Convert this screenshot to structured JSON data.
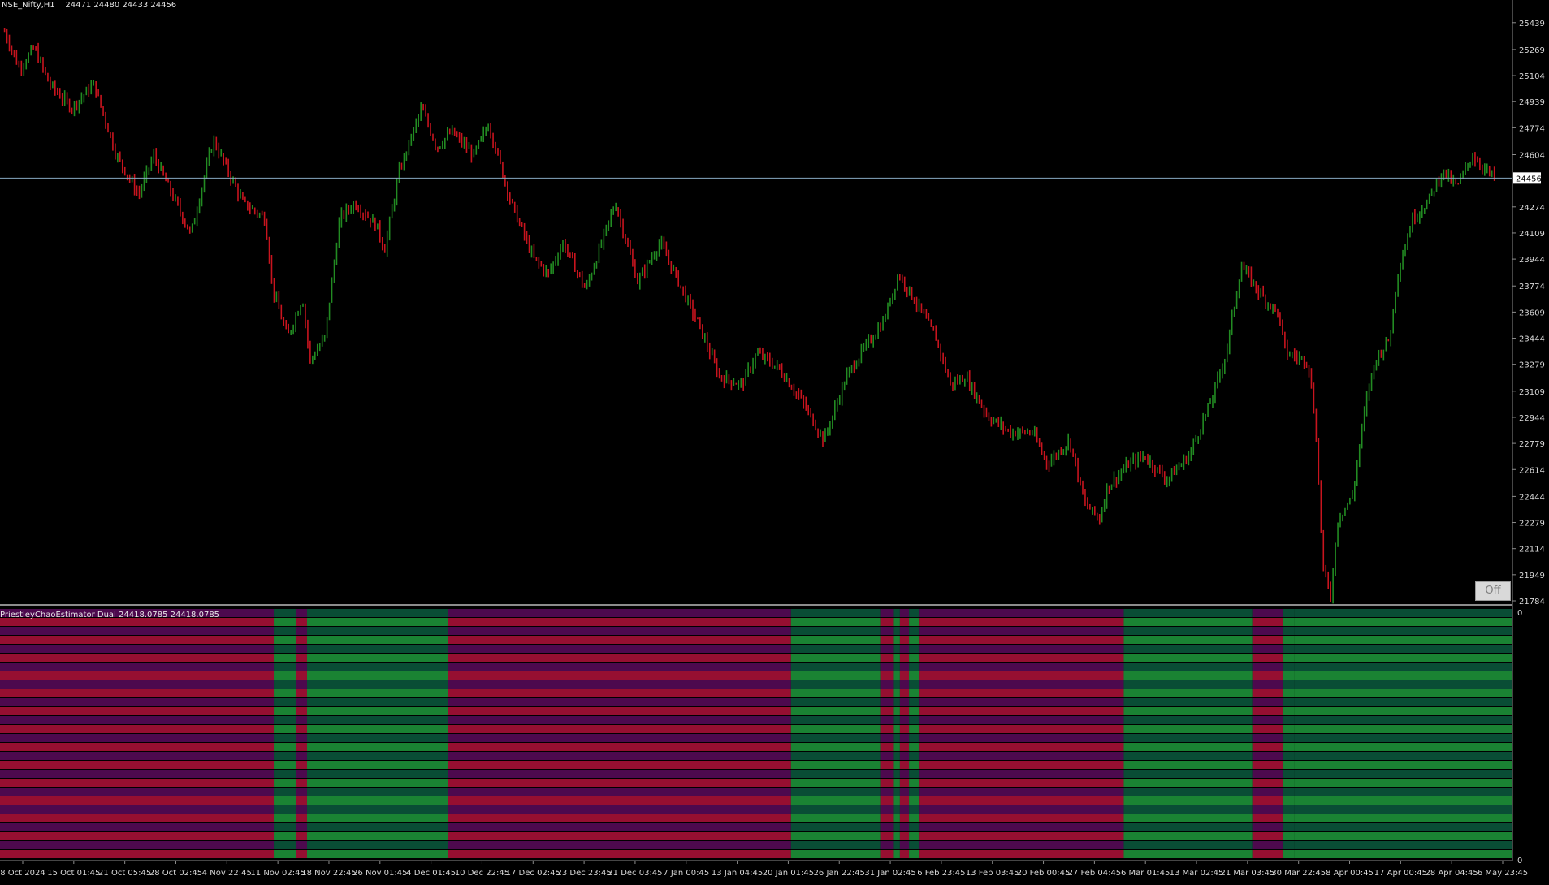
{
  "header": {
    "symbol": "NSE_Nifty,H1",
    "ohlc": "24471 24480 24433 24456"
  },
  "indicator": {
    "label": "PriestleyChaoEstimator Dual 24418.0785 24418.0785",
    "scale_top": "0",
    "scale_bottom": "0"
  },
  "off_button": {
    "label": "Off"
  },
  "colors": {
    "background": "#000000",
    "bull": "#228B22",
    "bear": "#C8141E",
    "current_price_line": "#87a9c2",
    "grid_text": "#d8d8d8",
    "heat_bear": "#b0123a",
    "heat_bear_alt": "#5a0a5c",
    "heat_bull": "#1e9a3c",
    "heat_bull_alt": "#0b5a3e"
  },
  "chart_data": {
    "type": "candlestick",
    "timeframe": "H1",
    "current_price": 24456,
    "current_price_label": "24456",
    "ylim": [
      21784,
      25520
    ],
    "y_ticks": [
      "25439",
      "25269",
      "25104",
      "24939",
      "24774",
      "24604",
      "24274",
      "24109",
      "23944",
      "23774",
      "23609",
      "23444",
      "23279",
      "23109",
      "22944",
      "22779",
      "22614",
      "22444",
      "22279",
      "22114",
      "21949",
      "21784"
    ],
    "x_ticks": [
      "8 Oct 2024",
      "15 Oct 01:45",
      "21 Oct 05:45",
      "28 Oct 02:45",
      "4 Nov 22:45",
      "11 Nov 02:45",
      "18 Nov 22:45",
      "26 Nov 01:45",
      "4 Dec 01:45",
      "10 Dec 22:45",
      "17 Dec 02:45",
      "23 Dec 23:45",
      "31 Dec 03:45",
      "7 Jan 00:45",
      "13 Jan 04:45",
      "20 Jan 01:45",
      "26 Jan 22:45",
      "31 Jan 02:45",
      "6 Feb 23:45",
      "13 Feb 03:45",
      "20 Feb 00:45",
      "27 Feb 04:45",
      "6 Mar 01:45",
      "13 Mar 02:45",
      "21 Mar 03:45",
      "30 Mar 22:45",
      "8 Apr 00:45",
      "17 Apr 00:45",
      "28 Apr 04:45",
      "6 May 23:45"
    ],
    "price_path": [
      [
        0,
        25380
      ],
      [
        0.01,
        25150
      ],
      [
        0.02,
        25280
      ],
      [
        0.03,
        25050
      ],
      [
        0.045,
        24900
      ],
      [
        0.06,
        25050
      ],
      [
        0.075,
        24600
      ],
      [
        0.09,
        24350
      ],
      [
        0.1,
        24600
      ],
      [
        0.11,
        24400
      ],
      [
        0.125,
        24100
      ],
      [
        0.14,
        24700
      ],
      [
        0.16,
        24300
      ],
      [
        0.175,
        24200
      ],
      [
        0.18,
        23750
      ],
      [
        0.19,
        23450
      ],
      [
        0.2,
        23700
      ],
      [
        0.205,
        23300
      ],
      [
        0.215,
        23450
      ],
      [
        0.225,
        24200
      ],
      [
        0.235,
        24300
      ],
      [
        0.25,
        24150
      ],
      [
        0.255,
        24000
      ],
      [
        0.265,
        24500
      ],
      [
        0.28,
        24900
      ],
      [
        0.29,
        24650
      ],
      [
        0.3,
        24750
      ],
      [
        0.315,
        24600
      ],
      [
        0.325,
        24800
      ],
      [
        0.34,
        24300
      ],
      [
        0.355,
        23950
      ],
      [
        0.365,
        23850
      ],
      [
        0.375,
        24050
      ],
      [
        0.39,
        23750
      ],
      [
        0.41,
        24300
      ],
      [
        0.425,
        23800
      ],
      [
        0.44,
        24050
      ],
      [
        0.455,
        23750
      ],
      [
        0.465,
        23550
      ],
      [
        0.48,
        23200
      ],
      [
        0.495,
        23150
      ],
      [
        0.505,
        23350
      ],
      [
        0.52,
        23250
      ],
      [
        0.535,
        23050
      ],
      [
        0.55,
        22800
      ],
      [
        0.565,
        23200
      ],
      [
        0.575,
        23350
      ],
      [
        0.59,
        23550
      ],
      [
        0.6,
        23850
      ],
      [
        0.61,
        23700
      ],
      [
        0.625,
        23450
      ],
      [
        0.635,
        23150
      ],
      [
        0.645,
        23200
      ],
      [
        0.66,
        22950
      ],
      [
        0.675,
        22850
      ],
      [
        0.69,
        22850
      ],
      [
        0.7,
        22650
      ],
      [
        0.715,
        22800
      ],
      [
        0.725,
        22400
      ],
      [
        0.735,
        22300
      ],
      [
        0.74,
        22500
      ],
      [
        0.755,
        22650
      ],
      [
        0.765,
        22700
      ],
      [
        0.78,
        22550
      ],
      [
        0.795,
        22700
      ],
      [
        0.81,
        23050
      ],
      [
        0.82,
        23350
      ],
      [
        0.83,
        23900
      ],
      [
        0.845,
        23700
      ],
      [
        0.855,
        23600
      ],
      [
        0.86,
        23350
      ],
      [
        0.875,
        23300
      ],
      [
        0.88,
        22900
      ],
      [
        0.885,
        22000
      ],
      [
        0.89,
        21800
      ],
      [
        0.895,
        22300
      ],
      [
        0.905,
        22450
      ],
      [
        0.91,
        22800
      ],
      [
        0.915,
        23100
      ],
      [
        0.92,
        23300
      ],
      [
        0.93,
        23450
      ],
      [
        0.935,
        23850
      ],
      [
        0.945,
        24200
      ],
      [
        0.955,
        24300
      ],
      [
        0.965,
        24500
      ],
      [
        0.975,
        24400
      ],
      [
        0.985,
        24600
      ],
      [
        0.995,
        24500
      ],
      [
        1.0,
        24456
      ]
    ],
    "series": [
      {
        "name": "bull candles",
        "color": "#228B22"
      },
      {
        "name": "bear candles",
        "color": "#C8141E"
      }
    ],
    "indicator_regimes": [
      {
        "from": 0.0,
        "to": 0.181,
        "state": "bear"
      },
      {
        "from": 0.181,
        "to": 0.196,
        "state": "bull"
      },
      {
        "from": 0.196,
        "to": 0.203,
        "state": "bear"
      },
      {
        "from": 0.203,
        "to": 0.296,
        "state": "bull"
      },
      {
        "from": 0.296,
        "to": 0.523,
        "state": "bear"
      },
      {
        "from": 0.523,
        "to": 0.582,
        "state": "bull"
      },
      {
        "from": 0.582,
        "to": 0.591,
        "state": "bear"
      },
      {
        "from": 0.591,
        "to": 0.595,
        "state": "bull"
      },
      {
        "from": 0.595,
        "to": 0.601,
        "state": "bear"
      },
      {
        "from": 0.601,
        "to": 0.608,
        "state": "bull"
      },
      {
        "from": 0.608,
        "to": 0.743,
        "state": "bear"
      },
      {
        "from": 0.743,
        "to": 0.828,
        "state": "bull"
      },
      {
        "from": 0.828,
        "to": 0.848,
        "state": "bear"
      },
      {
        "from": 0.848,
        "to": 0.856,
        "state": "bull"
      },
      {
        "from": 0.856,
        "to": 1.0,
        "state": "bull"
      }
    ]
  }
}
